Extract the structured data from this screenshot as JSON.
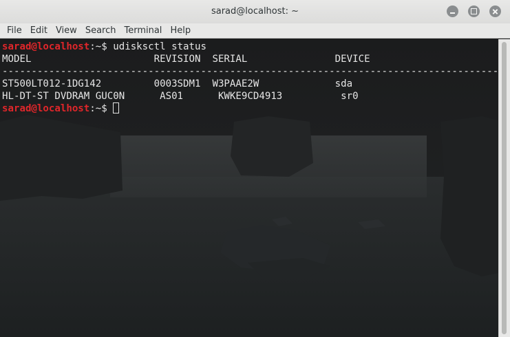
{
  "window": {
    "title": "sarad@localhost: ~"
  },
  "menu": [
    "File",
    "Edit",
    "View",
    "Search",
    "Terminal",
    "Help"
  ],
  "terminal": {
    "prompt_user": "sarad@localhost",
    "prompt_suffix": ":~$ ",
    "command": "udisksctl status",
    "header": "MODEL                     REVISION  SERIAL               DEVICE",
    "separator": "--------------------------------------------------------------------------------------",
    "rows": [
      "ST500LT012-1DG142         0003SDM1  W3PAAE2W             sda",
      "HL-DT-ST DVDRAM GUC0N      AS01      KWKE9CD4913          sr0"
    ]
  },
  "colors": {
    "prompt": "#e0262a",
    "text": "#e6e6e6",
    "chrome": "#e8e8e7"
  }
}
